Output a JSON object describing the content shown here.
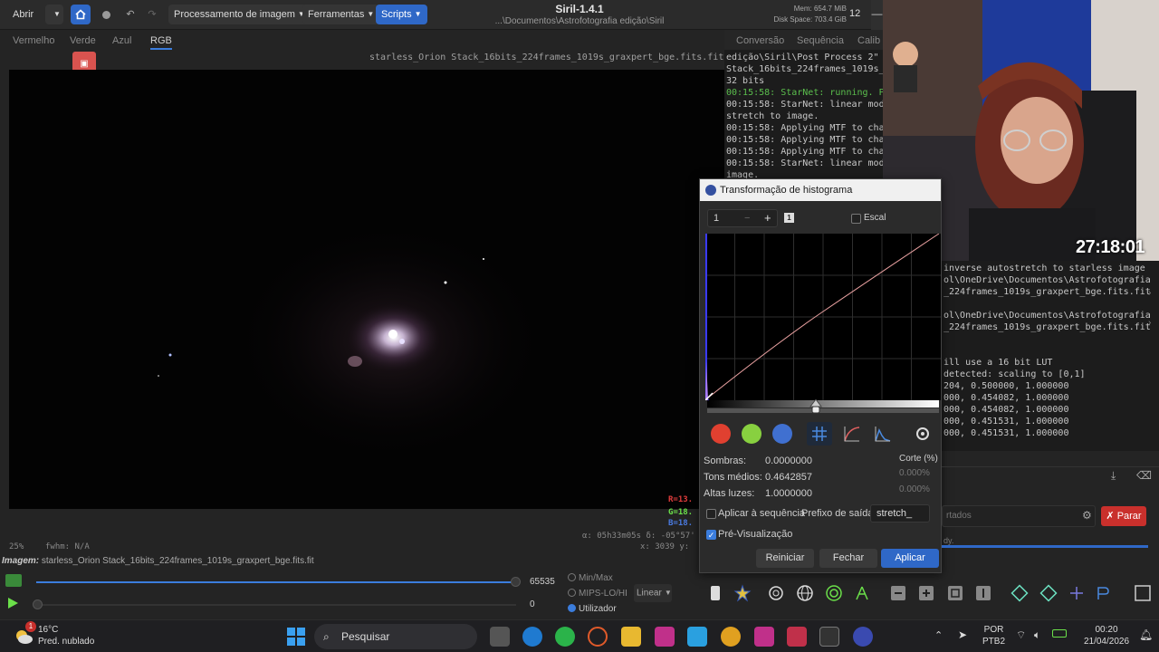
{
  "header": {
    "open_label": "Abrir",
    "menus": [
      "Processamento de imagem",
      "Ferramentas",
      "Scripts"
    ],
    "title": "Siril-1.4.1",
    "subtitle": "...\\Documentos\\Astrofotografia edição\\Siril",
    "mem": "Mem: 654.7 MiB",
    "disk": "Disk Space: 703.4 GiB",
    "cpu": "12"
  },
  "tabs": [
    "Vermelho",
    "Verde",
    "Azul",
    "RGB"
  ],
  "active_tab": "RGB",
  "right_tabs": [
    "Conversão",
    "Sequência",
    "Calib"
  ],
  "image": {
    "filename": "starless_Orion Stack_16bits_224frames_1019s_graxpert_bge.fits.fit",
    "zoom": "25%",
    "fwhm": "fwhm: N/A",
    "radec": "α: 05h33m05s  δ: -05°57'",
    "xy": "x: 3039  y:",
    "r": "R=13.",
    "g": "G=18.",
    "b": "B=18."
  },
  "log": [
    {
      "t": "edição\\Siril\\Post Process 2\"",
      "c": "#c8c8c8"
    },
    {
      "t": "Stack_16bits_224frames_1019s_",
      "c": "#c8c8c8"
    },
    {
      "t": "32 bits",
      "c": "#c8c8c8"
    },
    {
      "t": "00:15:58: StarNet: running. P",
      "c": "#5bbf4d"
    },
    {
      "t": "00:15:58: StarNet: linear mod",
      "c": "#c8c8c8"
    },
    {
      "t": "stretch to image.",
      "c": "#c8c8c8"
    },
    {
      "t": "00:15:58: Applying MTF to cha",
      "c": "#c8c8c8"
    },
    {
      "t": "00:15:58: Applying MTF to cha",
      "c": "#c8c8c8"
    },
    {
      "t": "00:15:58: Applying MTF to cha",
      "c": "#c8c8c8"
    },
    {
      "t": "00:15:58: StarNet: linear mod",
      "c": "#c8c8c8"
    },
    {
      "t": "image.",
      "c": "#c8c8c8"
    }
  ],
  "log2": [
    " inverse autostretch to starless image",
    "ol\\OneDrive\\Documentos\\Astrofotografia",
    "_224frames_1019s_graxpert_bge.fits.fit",
    "",
    "ol\\OneDrive\\Documentos\\Astrofotografia",
    "_224frames_1019s_graxpert_bge.fits.fit",
    "",
    "",
    "ill use a 16 bit LUT",
    " detected: scaling to [0,1]",
    "204, 0.500000, 1.000000",
    "000, 0.454082, 1.000000",
    "000, 0.454082, 1.000000",
    "000, 0.451531, 1.000000",
    "000, 0.451531, 1.000000"
  ],
  "stream": {
    "timer": "27:18:01"
  },
  "dialog": {
    "title": "Transformação de histograma",
    "zoom_value": "1",
    "minus": "−",
    "plus": "+",
    "badge": "1",
    "scale_label": "Escal",
    "shadows_label": "Sombras:",
    "shadows_value": "0.0000000",
    "midtones_label": "Tons médios:",
    "midtones_value": "0.4642857",
    "highlights_label": "Altas luzes:",
    "highlights_value": "1.0000000",
    "clip_label": "Corte (%)",
    "clip_shadows": "0.000%",
    "clip_highlights": "0.000%",
    "apply_seq_label": "Aplicar à sequência",
    "prefix_label": "Prefixo de saída:",
    "prefix_value": "stretch_",
    "preview_label": "Pré-Visualização",
    "reset_label": "Reiniciar",
    "close_label": "Fechar",
    "apply_label": "Aplicar"
  },
  "right_panel": {
    "input_placeholder": "rtados",
    "status": "dy.",
    "stop_label": "Parar"
  },
  "bottom": {
    "image_prefix": "Imagem:",
    "image_name": "starless_Orion Stack_16bits_224frames_1019s_graxpert_bge.fits.fit",
    "max_value": "65535",
    "min_value": "0",
    "modes": [
      "Min/Max",
      "MIPS-LO/HI",
      "Utilizador"
    ],
    "selected_mode": "Utilizador",
    "stretch": "Linear"
  },
  "taskbar": {
    "temp": "16°C",
    "weather": "Pred. nublado",
    "badge": "1",
    "search_placeholder": "Pesquisar",
    "lang1": "POR",
    "lang2": "PTB2",
    "time": "00:20",
    "date": "21/04/2026"
  }
}
